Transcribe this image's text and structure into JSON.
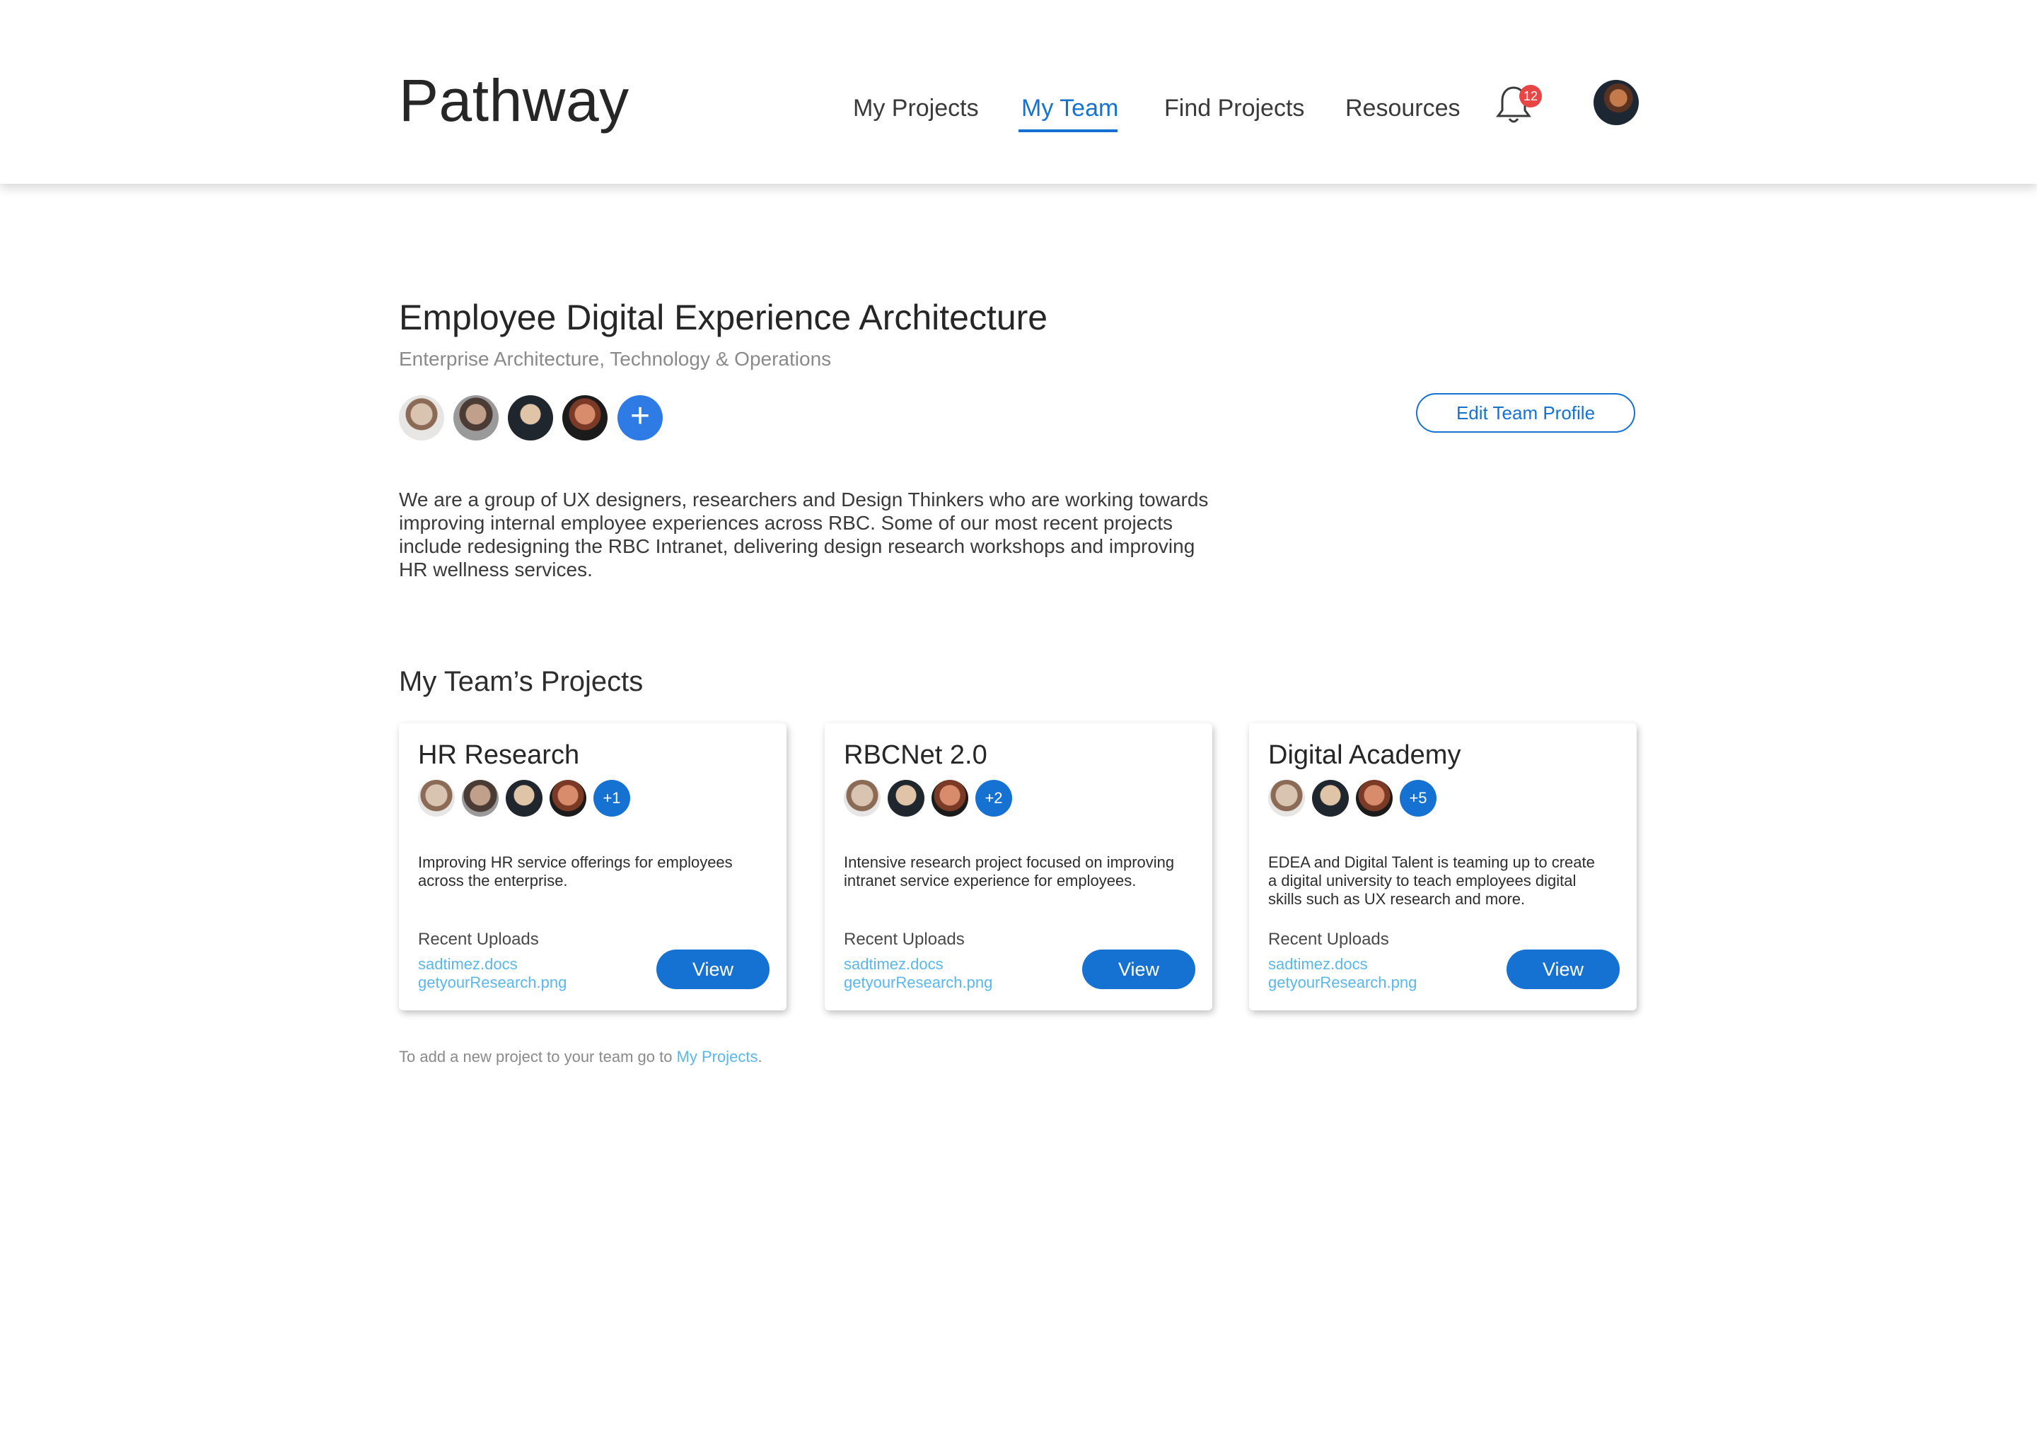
{
  "header": {
    "logo": "Pathway",
    "nav": [
      {
        "label": "My Projects",
        "active": false
      },
      {
        "label": "My Team",
        "active": true
      },
      {
        "label": "Find Projects",
        "active": false
      },
      {
        "label": "Resources",
        "active": false
      }
    ],
    "notification_count": "12",
    "icons": {
      "notifications": "bell-icon",
      "profile": "user-avatar"
    }
  },
  "team": {
    "title": "Employee Digital Experience Architecture",
    "subtitle": "Enterprise Architecture, Technology & Operations",
    "add_member_label": "+",
    "edit_button": "Edit Team Profile",
    "description": "We are a group of UX designers, researchers and Design Thinkers who are working towards improving internal employee experiences across RBC. Some of our most recent projects include redesigning the RBC Intranet, delivering design research workshops and improving HR wellness services."
  },
  "projects_section": {
    "title": "My Team’s Projects",
    "cards": [
      {
        "title": "HR Research",
        "extra_members": "+1",
        "description": "Improving HR service offerings for employees across the enterprise.",
        "uploads_label": "Recent Uploads",
        "uploads": [
          "sadtimez.docs",
          "getyourResearch.png"
        ],
        "view_label": "View"
      },
      {
        "title": "RBCNet 2.0",
        "extra_members": "+2",
        "description": "Intensive research project focused on improving intranet service experience for employees.",
        "uploads_label": "Recent Uploads",
        "uploads": [
          "sadtimez.docs",
          "getyourResearch.png"
        ],
        "view_label": "View"
      },
      {
        "title": "Digital Academy",
        "extra_members": "+5",
        "description": "EDEA and Digital Talent is teaming up to create a digital university to teach employees digital skills such as UX research and more.",
        "uploads_label": "Recent Uploads",
        "uploads": [
          "sadtimez.docs",
          "getyourResearch.png"
        ],
        "view_label": "View"
      }
    ]
  },
  "footer": {
    "text_before": "To add a new project to your team go to ",
    "link": "My Projects",
    "text_after": "."
  },
  "colors": {
    "accent": "#1572d3",
    "link": "#5ab7ec",
    "badge": "#e84545",
    "add_button": "#2f7be6"
  }
}
